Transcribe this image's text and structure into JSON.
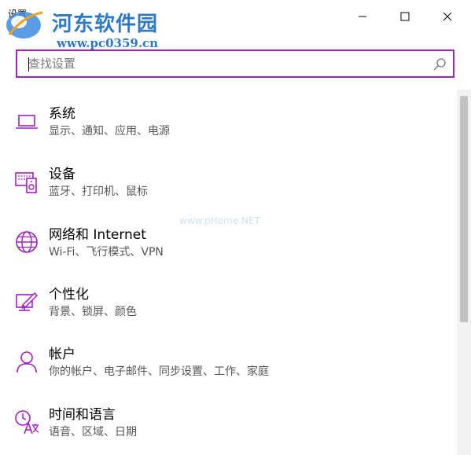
{
  "window": {
    "title": "设置",
    "controls": {
      "minimize": "minimize-icon",
      "maximize": "maximize-icon",
      "close": "close-icon"
    }
  },
  "watermark": {
    "name": "河东软件园",
    "url": "www.pc0359.cn",
    "faint": "www.pHome.NET"
  },
  "search": {
    "placeholder": "查找设置",
    "value": "",
    "icon": "search-icon"
  },
  "accent_color": "#a020c0",
  "categories": [
    {
      "title": "系统",
      "desc": "显示、通知、应用、电源",
      "icon": "laptop-icon"
    },
    {
      "title": "设备",
      "desc": "蓝牙、打印机、鼠标",
      "icon": "devices-icon"
    },
    {
      "title": "网络和 Internet",
      "desc": "Wi-Fi、飞行模式、VPN",
      "icon": "globe-icon"
    },
    {
      "title": "个性化",
      "desc": "背景、锁屏、颜色",
      "icon": "paint-icon"
    },
    {
      "title": "帐户",
      "desc": "你的帐户、电子邮件、同步设置、工作、家庭",
      "icon": "person-icon"
    },
    {
      "title": "时间和语言",
      "desc": "语音、区域、日期",
      "icon": "time-language-icon"
    }
  ]
}
